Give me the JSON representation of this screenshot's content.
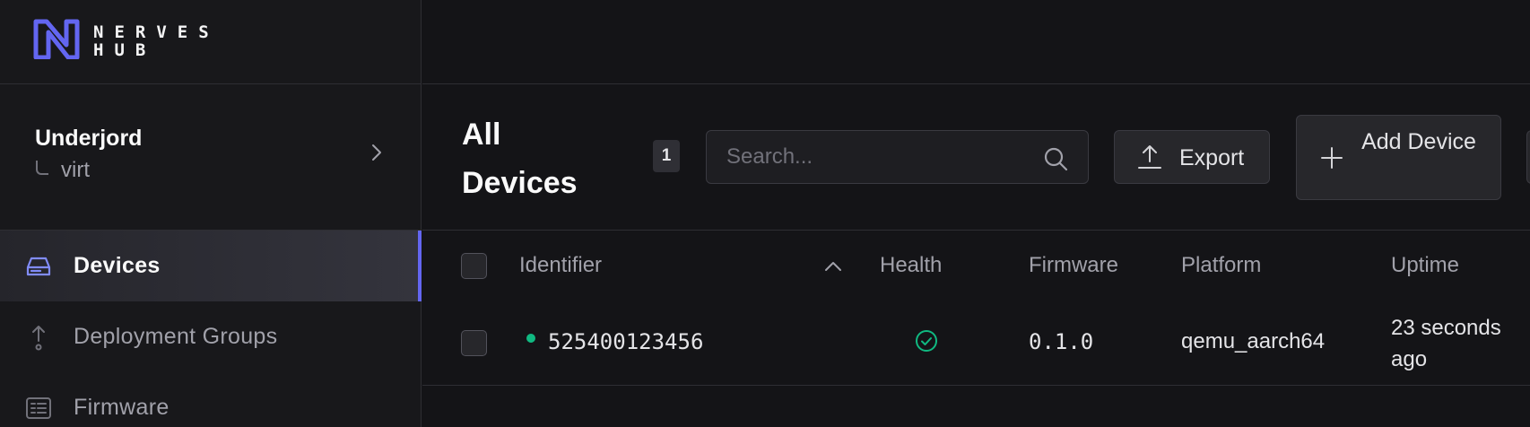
{
  "brand": {
    "line1": "NERVES",
    "line2": "HUB",
    "accent": "#6366f1"
  },
  "org": {
    "name": "Underjord",
    "product": "virt"
  },
  "nav": [
    {
      "label": "Devices",
      "icon": "hard-drive-icon",
      "active": true
    },
    {
      "label": "Deployment Groups",
      "icon": "deploy-icon",
      "active": false
    },
    {
      "label": "Firmware",
      "icon": "firmware-icon",
      "active": false
    }
  ],
  "header": {
    "title": "All Devices",
    "count": "1",
    "search_placeholder": "Search...",
    "export_label": "Export",
    "add_label": "Add Device"
  },
  "table": {
    "columns": [
      "Identifier",
      "Health",
      "Firmware",
      "Platform",
      "Uptime"
    ],
    "rows": [
      {
        "identifier": "525400123456",
        "status": "online",
        "health": "healthy",
        "firmware": "0.1.0",
        "platform": "qemu_aarch64",
        "uptime": "23 seconds ago"
      }
    ]
  },
  "colors": {
    "online": "#10b981",
    "active_border": "#6366f1"
  }
}
